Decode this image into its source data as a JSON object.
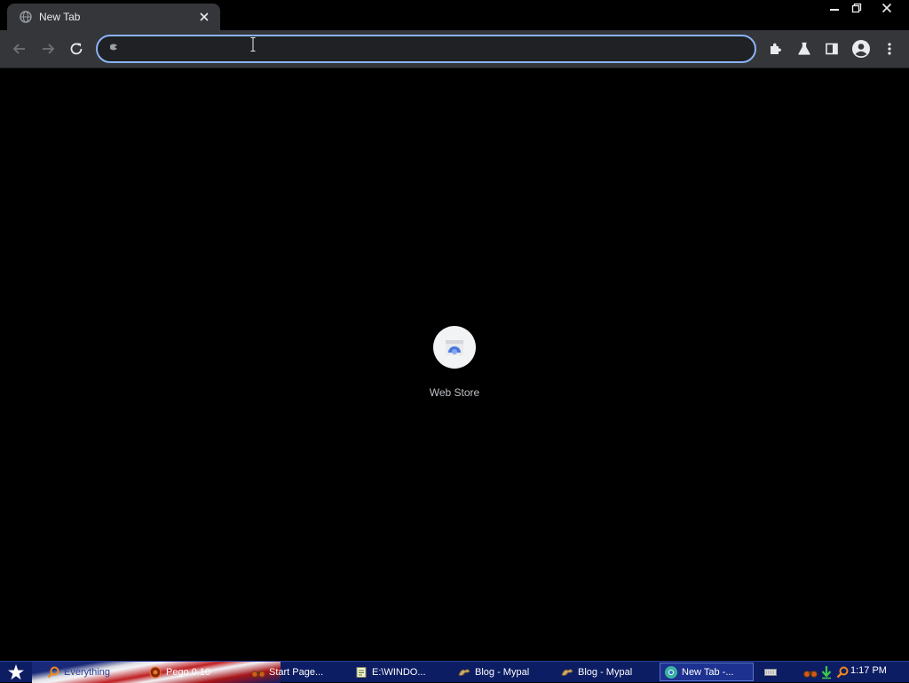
{
  "browser": {
    "tab": {
      "title": "New Tab",
      "favicon": "globe-icon",
      "close_icon": "close-icon"
    },
    "window_controls": [
      "minimize-icon",
      "restore-icon",
      "close-icon"
    ],
    "toolbar": {
      "nav": [
        "back-arrow-icon",
        "forward-arrow-icon",
        "reload-icon"
      ],
      "omnibox": {
        "value": "",
        "placeholder": "",
        "icon": "search-engine-icon"
      },
      "right_icons": [
        "extensions-puzzle-icon",
        "labs-flask-icon",
        "side-panel-icon",
        "profile-avatar-icon",
        "menu-kebab-icon"
      ]
    },
    "new_tab": {
      "shortcuts": [
        {
          "label": "Web Store",
          "icon": "web-store-icon"
        }
      ]
    },
    "colors": {
      "accent": "#8ab4f8",
      "toolbar": "#35363a",
      "background": "#000000"
    }
  },
  "taskbar": {
    "start_icon": "star-start-icon",
    "tasks": [
      {
        "label": "Everything",
        "icon": "search-icon",
        "active": false
      },
      {
        "label": "Pego 0.10",
        "icon": "pego-icon",
        "active": false
      },
      {
        "label": "Start Page...",
        "icon": "binoculars-icon",
        "active": false
      },
      {
        "label": "E:\\WINDO...",
        "icon": "notepad-icon",
        "active": false
      },
      {
        "label": "Blog - Mypal",
        "icon": "mypal-icon",
        "active": false
      },
      {
        "label": "Blog - Mypal",
        "icon": "mypal-icon",
        "active": false
      },
      {
        "label": "New Tab -...",
        "icon": "chromium-icon",
        "active": true
      }
    ],
    "tray_icons": [
      "keyboard-icon",
      "binoculars-icon",
      "download-arrow-icon",
      "search-icon"
    ],
    "clock": "1:17 PM"
  }
}
